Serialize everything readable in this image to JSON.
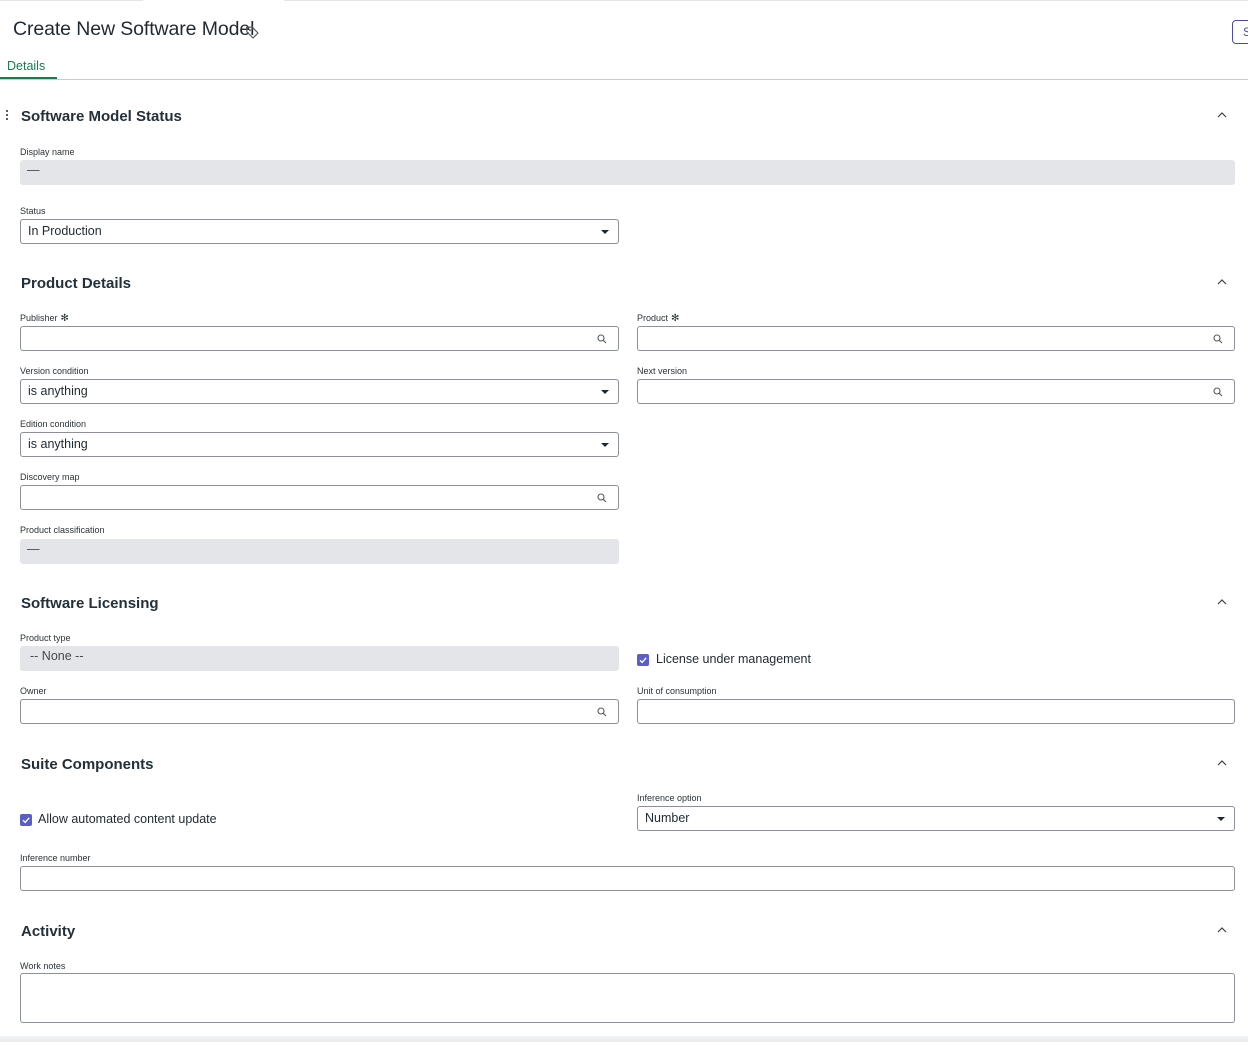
{
  "header": {
    "title": "Create New Software Model",
    "tag_icon": "tag-icon",
    "partial_button_label": "S"
  },
  "tabs": [
    {
      "label": "Details",
      "active": true
    }
  ],
  "colors": {
    "accent_green": "#1d7a4f",
    "checkbox": "#5b5ec4",
    "readonly_bg": "#e3e5e8"
  },
  "sections": {
    "status": {
      "title": "Software Model Status",
      "display_name": {
        "label": "Display name",
        "value": "—"
      },
      "status": {
        "label": "Status",
        "value": "In Production"
      }
    },
    "product_details": {
      "title": "Product Details",
      "publisher": {
        "label": "Publisher",
        "required_mark": "✻",
        "value": ""
      },
      "product": {
        "label": "Product",
        "required_mark": "✻",
        "value": ""
      },
      "version_condition": {
        "label": "Version condition",
        "value": "is anything"
      },
      "next_version": {
        "label": "Next version",
        "value": ""
      },
      "edition_condition": {
        "label": "Edition condition",
        "value": "is anything"
      },
      "discovery_map": {
        "label": "Discovery map",
        "value": ""
      },
      "product_classification": {
        "label": "Product classification",
        "value": "—"
      }
    },
    "licensing": {
      "title": "Software Licensing",
      "product_type": {
        "label": "Product type",
        "value": "-- None --"
      },
      "license_under_management": {
        "label": "License under management",
        "checked": true
      },
      "owner": {
        "label": "Owner",
        "value": ""
      },
      "unit_of_consumption": {
        "label": "Unit of consumption",
        "value": ""
      }
    },
    "suite": {
      "title": "Suite Components",
      "allow_update": {
        "label": "Allow automated content update",
        "checked": true
      },
      "inference_option": {
        "label": "Inference option",
        "value": "Number"
      },
      "inference_number": {
        "label": "Inference number",
        "value": ""
      }
    },
    "activity": {
      "title": "Activity",
      "work_notes": {
        "label": "Work notes",
        "value": ""
      }
    }
  }
}
